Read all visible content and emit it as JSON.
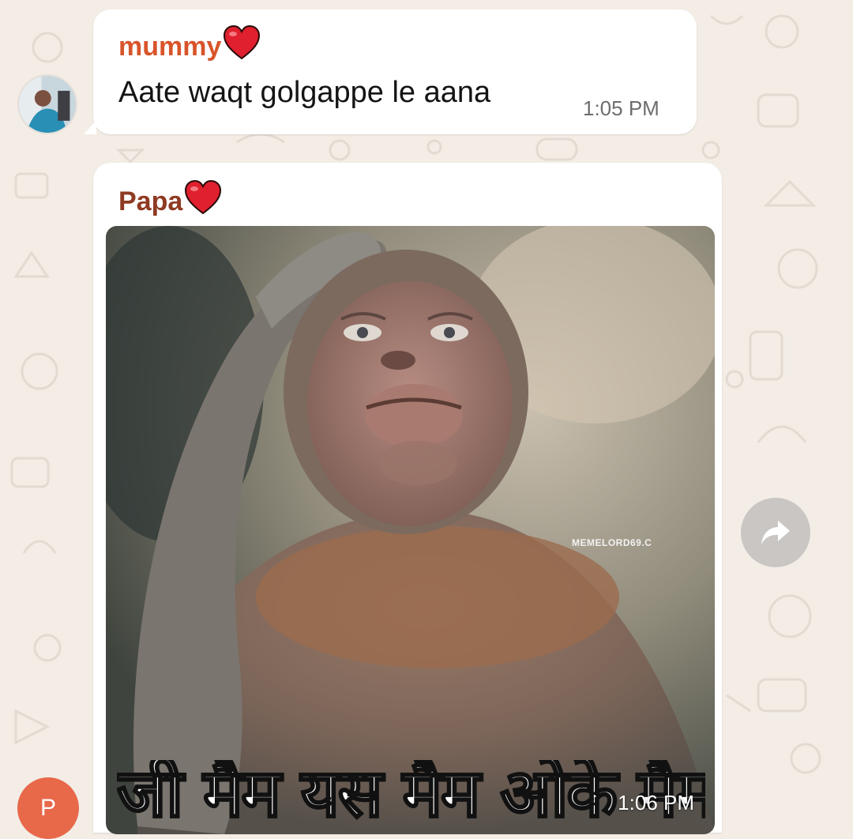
{
  "messages": [
    {
      "sender": "mummy",
      "text": "Aate waqt golgappe le aana",
      "time": "1:05 PM"
    },
    {
      "sender": "Papa",
      "image_caption": "जी मैम यस मैम ओके मैम",
      "watermark": "MEMELORD69.C",
      "time": "1:06 PM"
    }
  ],
  "papa_avatar_initial": "P",
  "icons": {
    "heart": "red-heart-emoji",
    "forward": "forward-arrow-icon"
  },
  "colors": {
    "background": "#f3ede6",
    "mummy_name": "#d9542a",
    "papa_name": "#8f3a22",
    "papa_avatar": "#e8684a",
    "heart": "#e0202e"
  }
}
